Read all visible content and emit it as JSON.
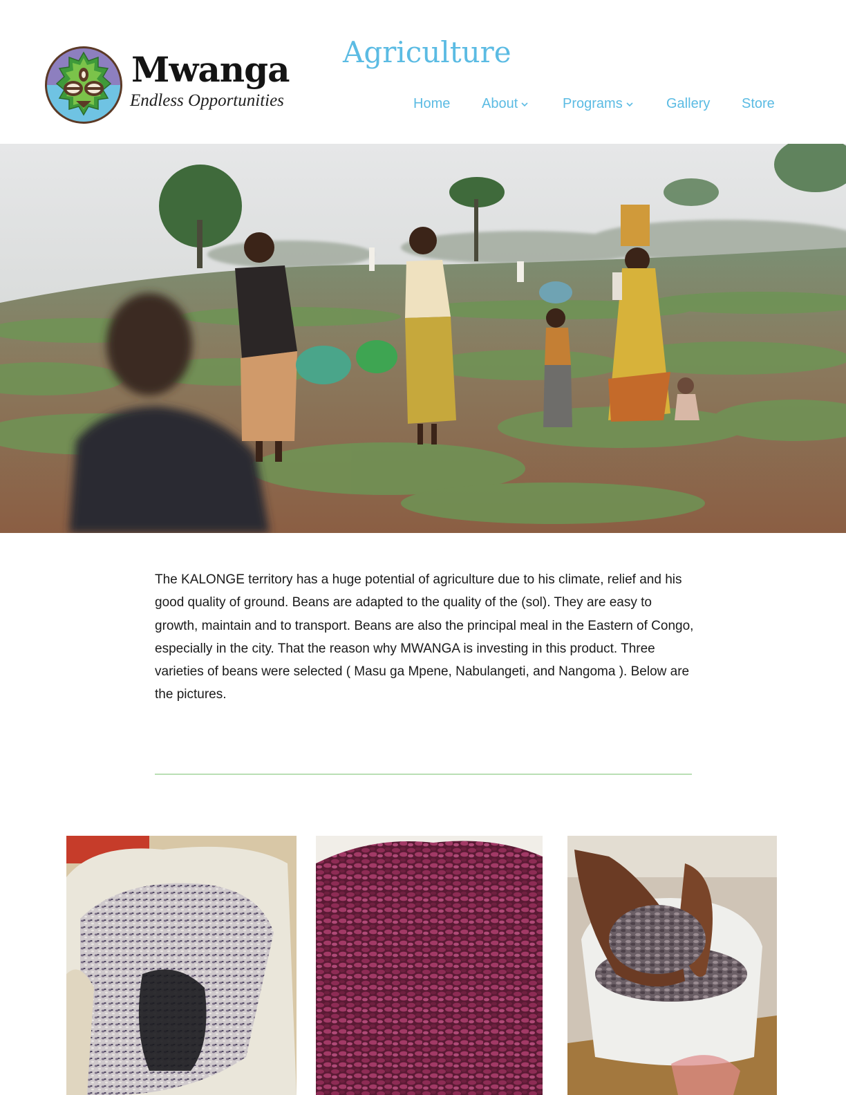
{
  "brand": {
    "name": "Mwanga",
    "tagline": "Endless Opportunities"
  },
  "page": {
    "title": "Agriculture"
  },
  "nav": {
    "items": [
      {
        "label": "Home",
        "has_dropdown": false
      },
      {
        "label": "About",
        "has_dropdown": true
      },
      {
        "label": "Programs",
        "has_dropdown": true
      },
      {
        "label": "Gallery",
        "has_dropdown": false
      },
      {
        "label": "Store",
        "has_dropdown": false
      }
    ]
  },
  "content": {
    "intro": "The KALONGE territory has a huge potential of agriculture due to his climate, relief and his good quality of ground. Beans are adapted to the quality of the (sol). They are easy to growth, maintain and to transport. Beans are also the principal meal in the Eastern of Congo, especially in the city. That the reason why MWANGA is investing in this product. Three varieties of beans were selected ( Masu ga Mpene, Nabulangeti, and Nangoma ). Below are the pictures."
  },
  "colors": {
    "accent": "#5bbbe3",
    "divider": "#b9dfb4",
    "text": "#1a1a1a"
  },
  "icons": {
    "dropdown": "chevron-down-icon"
  }
}
